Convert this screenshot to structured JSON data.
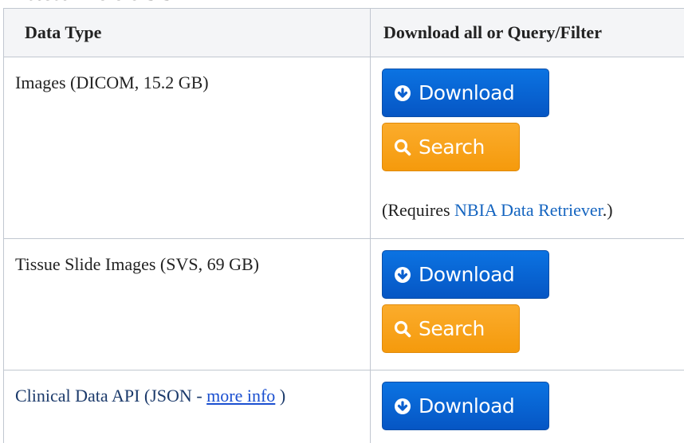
{
  "page": {
    "heading": "Data Access"
  },
  "table": {
    "headers": {
      "data_type": "Data Type",
      "download_query": "Download all or Query/Filter"
    },
    "rows": [
      {
        "data_type": "Images (DICOM, 15.2 GB)",
        "download_label": "Download",
        "search_label": "Search",
        "note_prefix": "(Requires ",
        "note_link": "NBIA Data Retriever",
        "note_suffix": ".)"
      },
      {
        "data_type": "Tissue Slide Images (SVS, 69 GB)",
        "download_label": "Download",
        "search_label": "Search"
      },
      {
        "data_type_prefix": "Clinical Data API (JSON - ",
        "data_type_link": "more info",
        "data_type_suffix": " )",
        "download_label": "Download"
      }
    ]
  },
  "icons": {
    "download": "circle-arrow-down-icon",
    "search": "magnifier-icon"
  },
  "colors": {
    "download_button": "#0a66d6",
    "search_button": "#f8a21c",
    "link": "#1565c0",
    "table_border": "#c1c7d0",
    "header_background": "#f4f5f7"
  }
}
